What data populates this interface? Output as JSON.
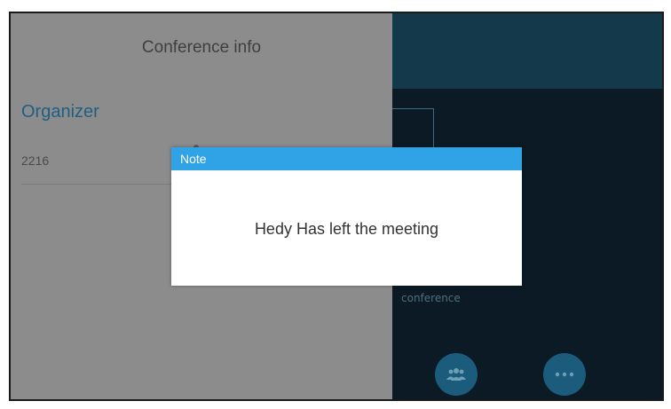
{
  "panel": {
    "title": "Conference info",
    "section_heading": "Organizer",
    "members": [
      "2216"
    ]
  },
  "background": {
    "conference_label": "conference",
    "buttons": [
      {
        "icon": "contacts-icon"
      },
      {
        "icon": "more-icon"
      }
    ]
  },
  "dialog": {
    "title": "Note",
    "message": "Hedy Has left the meeting"
  },
  "colors": {
    "dialog_header": "#2fa3e6",
    "section_heading": "#1e5f84",
    "button_fill": "#1b5c7d",
    "overlay_panel": "#8c8c8c"
  }
}
